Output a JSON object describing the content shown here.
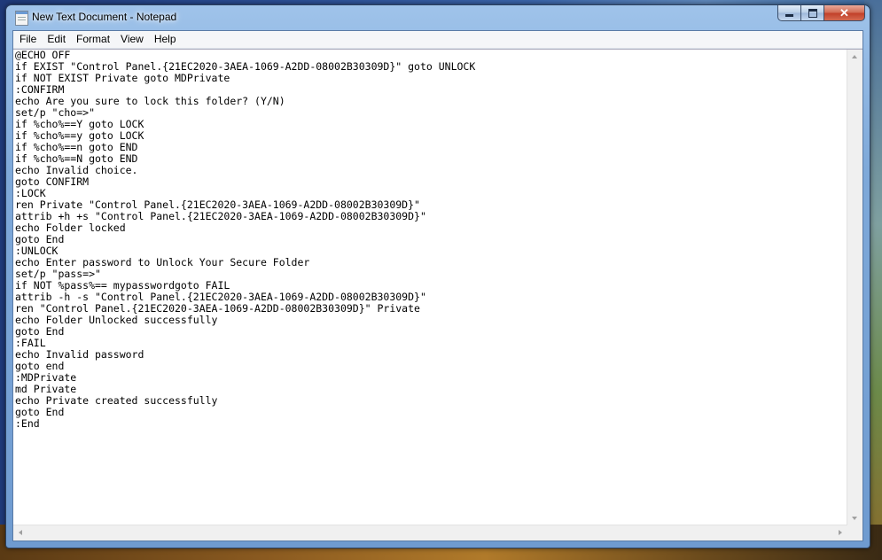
{
  "window": {
    "title": "New Text Document - Notepad",
    "app_icon": "notepad-icon",
    "controls": {
      "minimize": "minimize-icon",
      "maximize": "maximize-icon",
      "close": "close-icon",
      "close_glyph": "✕"
    }
  },
  "menu": [
    "File",
    "Edit",
    "Format",
    "View",
    "Help"
  ],
  "document": {
    "lines": [
      "@ECHO OFF",
      "if EXIST \"Control Panel.{21EC2020-3AEA-1069-A2DD-08002B30309D}\" goto UNLOCK",
      "if NOT EXIST Private goto MDPrivate",
      ":CONFIRM",
      "echo Are you sure to lock this folder? (Y/N)",
      "set/p \"cho=>\"",
      "if %cho%==Y goto LOCK",
      "if %cho%==y goto LOCK",
      "if %cho%==n goto END",
      "if %cho%==N goto END",
      "echo Invalid choice.",
      "goto CONFIRM",
      ":LOCK",
      "ren Private \"Control Panel.{21EC2020-3AEA-1069-A2DD-08002B30309D}\"",
      "attrib +h +s \"Control Panel.{21EC2020-3AEA-1069-A2DD-08002B30309D}\"",
      "echo Folder locked",
      "goto End",
      ":UNLOCK",
      "echo Enter password to Unlock Your Secure Folder",
      "set/p \"pass=>\"",
      "if NOT %pass%== mypasswordgoto FAIL",
      "attrib -h -s \"Control Panel.{21EC2020-3AEA-1069-A2DD-08002B30309D}\"",
      "ren \"Control Panel.{21EC2020-3AEA-1069-A2DD-08002B30309D}\" Private",
      "echo Folder Unlocked successfully",
      "goto End",
      ":FAIL",
      "echo Invalid password",
      "goto end",
      ":MDPrivate",
      "md Private",
      "echo Private created successfully",
      "goto End",
      ":End"
    ]
  }
}
